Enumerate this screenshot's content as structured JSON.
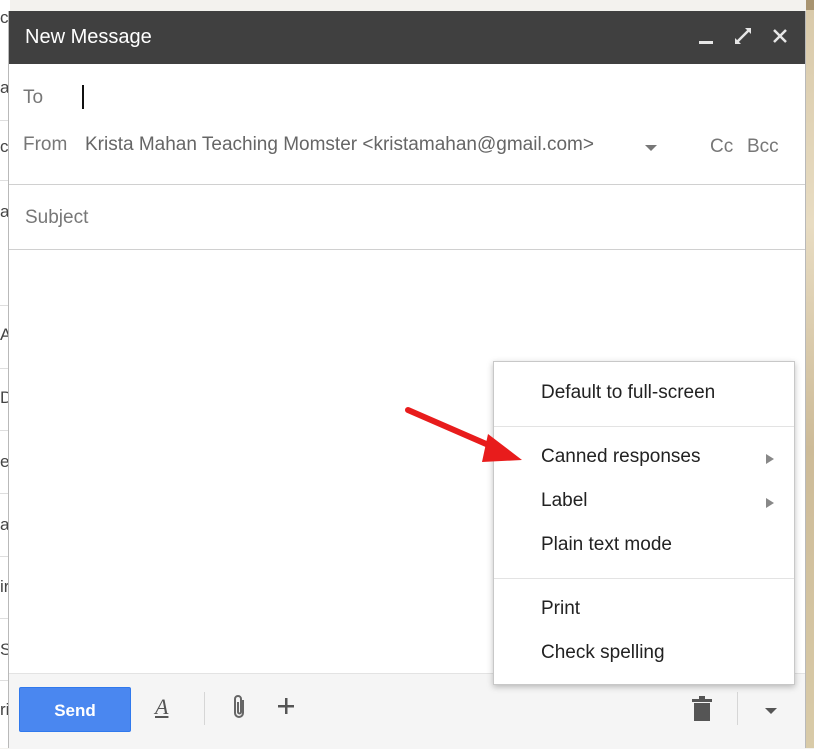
{
  "background": {
    "left_row_glyphs": [
      "ci",
      "a",
      "c",
      "a:",
      "",
      "A",
      "D",
      "e",
      "a",
      "ir",
      "S",
      "ri"
    ]
  },
  "window": {
    "title": "New Message",
    "controls": [
      "minimize-icon",
      "expand-icon",
      "close-icon"
    ]
  },
  "to": {
    "label": "To",
    "value": ""
  },
  "from": {
    "label": "From",
    "value": "Krista Mahan Teaching Momster <kristamahan@gmail.com>",
    "cc_label": "Cc",
    "bcc_label": "Bcc"
  },
  "subject": {
    "placeholder": "Subject",
    "value": ""
  },
  "toolbar": {
    "send_label": "Send",
    "format_icon": "text-format-icon",
    "attach_icon": "paperclip-icon",
    "plus_icon": "plus-icon",
    "trash_icon": "trash-icon",
    "more_icon": "chevron-down-icon"
  },
  "menu": {
    "items": [
      {
        "label": "Default to full-screen",
        "submenu": false
      },
      {
        "label": "Canned responses",
        "submenu": true
      },
      {
        "label": "Label",
        "submenu": true
      },
      {
        "label": "Plain text mode",
        "submenu": false
      },
      {
        "label": "Print",
        "submenu": false
      },
      {
        "label": "Check spelling",
        "submenu": false
      }
    ]
  },
  "colors": {
    "titlebar": "#404040",
    "send_button": "#4a87f0",
    "annotation_arrow": "#e81c1c"
  }
}
